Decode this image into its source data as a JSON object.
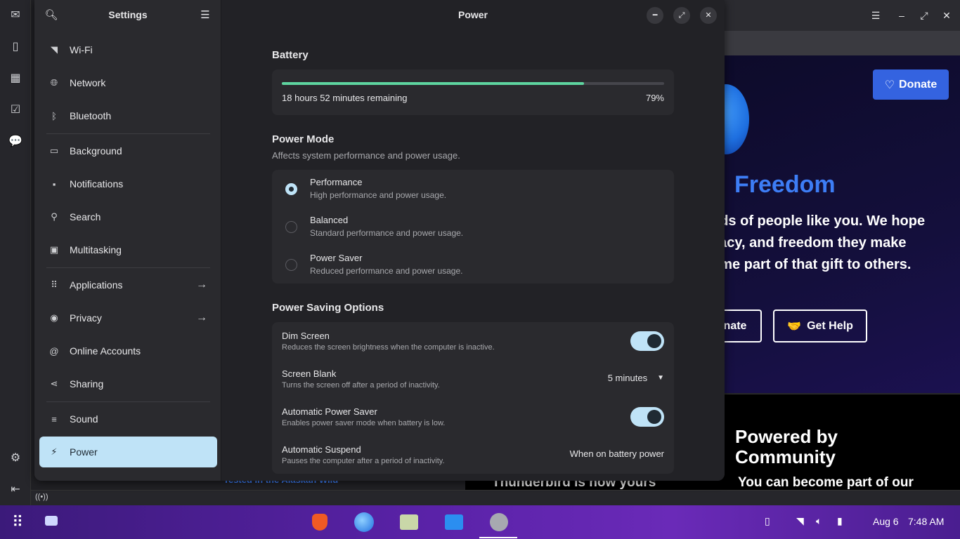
{
  "settings": {
    "title": "Settings",
    "sidebar": [
      {
        "label": "Wi-Fi",
        "icon": "wifi-icon"
      },
      {
        "label": "Network",
        "icon": "globe-icon"
      },
      {
        "label": "Bluetooth",
        "icon": "bluetooth-icon"
      },
      {
        "label": "Background",
        "icon": "display-icon"
      },
      {
        "label": "Notifications",
        "icon": "notification-icon"
      },
      {
        "label": "Search",
        "icon": "search-icon"
      },
      {
        "label": "Multitasking",
        "icon": "multitasking-icon"
      },
      {
        "label": "Applications",
        "icon": "apps-grid-icon",
        "arrow": true
      },
      {
        "label": "Privacy",
        "icon": "privacy-icon",
        "arrow": true
      },
      {
        "label": "Online Accounts",
        "icon": "at-sign-icon"
      },
      {
        "label": "Sharing",
        "icon": "share-icon"
      },
      {
        "label": "Sound",
        "icon": "sound-icon"
      },
      {
        "label": "Power",
        "icon": "power-icon",
        "active": true
      }
    ]
  },
  "power": {
    "title": "Power",
    "battery": {
      "section": "Battery",
      "remaining": "18 hours 52 minutes remaining",
      "percent_label": "79%",
      "level": 0.79
    },
    "mode": {
      "section": "Power Mode",
      "subtitle": "Affects system performance and power usage.",
      "options": [
        {
          "title": "Performance",
          "sub": "High performance and power usage.",
          "selected": true
        },
        {
          "title": "Balanced",
          "sub": "Standard performance and power usage.",
          "selected": false
        },
        {
          "title": "Power Saver",
          "sub": "Reduced performance and power usage.",
          "selected": false
        }
      ]
    },
    "saving": {
      "section": "Power Saving Options",
      "rows": [
        {
          "title": "Dim Screen",
          "sub": "Reduces the screen brightness when the computer is inactive.",
          "toggle": true
        },
        {
          "title": "Screen Blank",
          "sub": "Turns the screen off after a period of inactivity.",
          "value": "5 minutes"
        },
        {
          "title": "Automatic Power Saver",
          "sub": "Enables power saver mode when battery is low.",
          "toggle": true
        },
        {
          "title": "Automatic Suspend",
          "sub": "Pauses the computer after a period of inactivity.",
          "value": "When on battery power"
        }
      ]
    }
  },
  "background_app": {
    "donate_button": "Donate",
    "heading_fragment": "o",
    "heading_word": "Freedom",
    "para_lines": [
      "nds of people like you. We hope",
      "vacy, and freedom they make",
      "ome part of that gift to others."
    ],
    "donate_fragment": "nate",
    "get_help": "Get Help",
    "powered_line1": "Powered by",
    "powered_line2": "Community",
    "bottom_text": "You can become part of our",
    "bottom_left_text": "Thunderbird is now yours",
    "link_text": "Tested in the Alaskan Wild"
  },
  "taskbar": {
    "date": "Aug 6",
    "time": "7:48 AM"
  },
  "colors": {
    "accent": "#bfe3f7",
    "battery_fill": "#5ed5a0",
    "donate_blue": "#3463e0",
    "freedom_blue": "#3d7df5"
  }
}
